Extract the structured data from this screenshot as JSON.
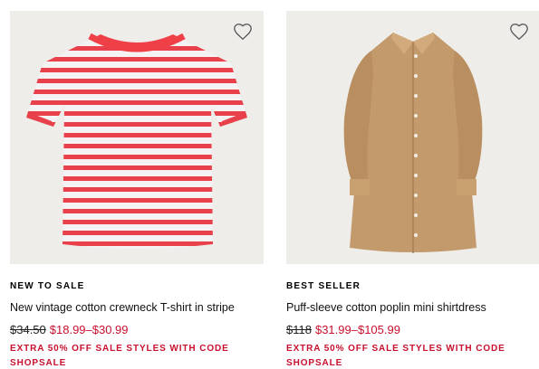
{
  "products": [
    {
      "badge": "NEW TO SALE",
      "name": "New vintage cotton crewneck T-shirt in stripe",
      "was_price": "$34.50",
      "sale_price": "$18.99–$30.99",
      "promo": "EXTRA 50% OFF SALE STYLES WITH CODE SHOPSALE",
      "image": "striped-tshirt-image"
    },
    {
      "badge": "BEST SELLER",
      "name": "Puff-sleeve cotton poplin mini shirtdress",
      "was_price": "$118",
      "sale_price": "$31.99–$105.99",
      "promo": "EXTRA 50% OFF SALE STYLES WITH CODE SHOPSALE",
      "image": "shirtdress-image"
    }
  ],
  "colors": {
    "sale_red": "#c8102e",
    "image_bg": "#efede9",
    "stripe_red": "#e8414b",
    "dress_tan": "#c39a6b"
  },
  "icons": {
    "favorite": "heart-outline-icon"
  }
}
